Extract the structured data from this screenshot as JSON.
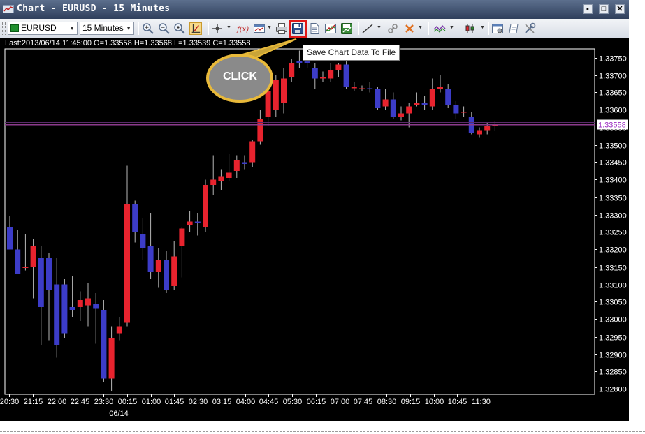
{
  "window": {
    "title": "Chart - EURUSD - 15 Minutes",
    "minimize_glyph": "▪",
    "restore_glyph": "□",
    "close_glyph": "✕"
  },
  "toolbar": {
    "symbol_value": "EURUSD",
    "timeframe_value": "15 Minutes",
    "icons": [
      "zoom-in-icon",
      "zoom-out-icon",
      "zoom-reset-icon",
      "auto-scroll-icon",
      "crosshair-icon",
      "indicator-fx-icon",
      "chart-type-icon",
      "print-icon",
      "save-icon",
      "document-icon",
      "line-chart-icon",
      "export-chart-icon",
      "trend-line-icon",
      "link-icon",
      "delete-objects-icon",
      "wave-icon",
      "candlestick-icon",
      "properties-icon",
      "template-icon",
      "tools-icon"
    ],
    "tooltip": "Save Chart Data To File"
  },
  "info_line": "Last:2013/06/14 11:45:00 O=1.33558 H=1.33568 L=1.33539 C=1.33558",
  "callout_label": "CLICK",
  "colors": {
    "bull": "#e8232e",
    "bear": "#3c3cc8",
    "axis": "#ffffff",
    "price_line": "#8b3a8b",
    "highlight": "#e01818"
  },
  "chart_data": {
    "type": "candlestick",
    "y_ticks": [
      "1.33750",
      "1.33700",
      "1.33650",
      "1.33600",
      "1.33550",
      "1.33500",
      "1.33450",
      "1.33400",
      "1.33350",
      "1.33300",
      "1.33250",
      "1.33200",
      "1.33150",
      "1.33100",
      "1.33050",
      "1.33000",
      "1.32950",
      "1.32900",
      "1.32850",
      "1.32800"
    ],
    "x_ticks": [
      "20:30",
      "21:15",
      "22:00",
      "22:45",
      "23:30",
      "00:15",
      "01:00",
      "01:45",
      "02:30",
      "03:15",
      "04:00",
      "04:45",
      "05:30",
      "06:15",
      "07:00",
      "07:45",
      "08:30",
      "09:15",
      "10:00",
      "10:45",
      "11:30"
    ],
    "date_label": "06/14",
    "ylim": [
      1.32785,
      1.33775
    ],
    "current_price": "1.33558",
    "candles": [
      {
        "o": 1.33265,
        "h": 1.33295,
        "l": 1.332,
        "c": 1.332
      },
      {
        "o": 1.332,
        "h": 1.33255,
        "l": 1.3313,
        "c": 1.3313
      },
      {
        "o": 1.3315,
        "h": 1.33245,
        "l": 1.3314,
        "c": 1.3315
      },
      {
        "o": 1.3315,
        "h": 1.3323,
        "l": 1.3306,
        "c": 1.3321
      },
      {
        "o": 1.33175,
        "h": 1.3321,
        "l": 1.32925,
        "c": 1.33035
      },
      {
        "o": 1.33175,
        "h": 1.3319,
        "l": 1.3294,
        "c": 1.33085
      },
      {
        "o": 1.331,
        "h": 1.33175,
        "l": 1.3289,
        "c": 1.32925
      },
      {
        "o": 1.331,
        "h": 1.33115,
        "l": 1.32945,
        "c": 1.3296
      },
      {
        "o": 1.33035,
        "h": 1.33125,
        "l": 1.33005,
        "c": 1.33025
      },
      {
        "o": 1.33035,
        "h": 1.3308,
        "l": 1.32995,
        "c": 1.33055
      },
      {
        "o": 1.3304,
        "h": 1.33105,
        "l": 1.3298,
        "c": 1.3306
      },
      {
        "o": 1.33045,
        "h": 1.33075,
        "l": 1.3293,
        "c": 1.3303
      },
      {
        "o": 1.33025,
        "h": 1.33055,
        "l": 1.3282,
        "c": 1.3283
      },
      {
        "o": 1.3283,
        "h": 1.3298,
        "l": 1.32795,
        "c": 1.32945
      },
      {
        "o": 1.3296,
        "h": 1.33005,
        "l": 1.3294,
        "c": 1.3298
      },
      {
        "o": 1.3299,
        "h": 1.3344,
        "l": 1.3298,
        "c": 1.3333
      },
      {
        "o": 1.3333,
        "h": 1.3334,
        "l": 1.3322,
        "c": 1.3325
      },
      {
        "o": 1.33245,
        "h": 1.3329,
        "l": 1.3317,
        "c": 1.33205
      },
      {
        "o": 1.3321,
        "h": 1.33305,
        "l": 1.33115,
        "c": 1.33135
      },
      {
        "o": 1.33135,
        "h": 1.33205,
        "l": 1.3309,
        "c": 1.3317
      },
      {
        "o": 1.3317,
        "h": 1.33195,
        "l": 1.33075,
        "c": 1.33085
      },
      {
        "o": 1.33095,
        "h": 1.33225,
        "l": 1.33085,
        "c": 1.3318
      },
      {
        "o": 1.3321,
        "h": 1.33265,
        "l": 1.3312,
        "c": 1.3326
      },
      {
        "o": 1.3327,
        "h": 1.3331,
        "l": 1.3325,
        "c": 1.3328
      },
      {
        "o": 1.3328,
        "h": 1.33305,
        "l": 1.3324,
        "c": 1.33275
      },
      {
        "o": 1.33265,
        "h": 1.334,
        "l": 1.3325,
        "c": 1.33385
      },
      {
        "o": 1.33385,
        "h": 1.3347,
        "l": 1.33355,
        "c": 1.334
      },
      {
        "o": 1.33395,
        "h": 1.3343,
        "l": 1.3337,
        "c": 1.3341
      },
      {
        "o": 1.33405,
        "h": 1.33475,
        "l": 1.33395,
        "c": 1.3342
      },
      {
        "o": 1.33425,
        "h": 1.3347,
        "l": 1.33405,
        "c": 1.33455
      },
      {
        "o": 1.3345,
        "h": 1.3347,
        "l": 1.3343,
        "c": 1.33445
      },
      {
        "o": 1.3345,
        "h": 1.33515,
        "l": 1.33435,
        "c": 1.3351
      },
      {
        "o": 1.3351,
        "h": 1.336,
        "l": 1.335,
        "c": 1.33575
      },
      {
        "o": 1.3358,
        "h": 1.3366,
        "l": 1.33555,
        "c": 1.33655
      },
      {
        "o": 1.336,
        "h": 1.337,
        "l": 1.3358,
        "c": 1.33685
      },
      {
        "o": 1.3362,
        "h": 1.3372,
        "l": 1.3359,
        "c": 1.3369
      },
      {
        "o": 1.33695,
        "h": 1.33745,
        "l": 1.3368,
        "c": 1.33735
      },
      {
        "o": 1.3374,
        "h": 1.3377,
        "l": 1.3372,
        "c": 1.33735
      },
      {
        "o": 1.3374,
        "h": 1.33745,
        "l": 1.3372,
        "c": 1.33735
      },
      {
        "o": 1.3372,
        "h": 1.33735,
        "l": 1.3366,
        "c": 1.3369
      },
      {
        "o": 1.3369,
        "h": 1.3371,
        "l": 1.3368,
        "c": 1.33695
      },
      {
        "o": 1.3369,
        "h": 1.33735,
        "l": 1.3368,
        "c": 1.33715
      },
      {
        "o": 1.33715,
        "h": 1.33735,
        "l": 1.33695,
        "c": 1.3373
      },
      {
        "o": 1.3373,
        "h": 1.3374,
        "l": 1.3366,
        "c": 1.33665
      },
      {
        "o": 1.33665,
        "h": 1.3368,
        "l": 1.33655,
        "c": 1.33665
      },
      {
        "o": 1.3366,
        "h": 1.3367,
        "l": 1.33655,
        "c": 1.33662
      },
      {
        "o": 1.33662,
        "h": 1.3368,
        "l": 1.3365,
        "c": 1.3366
      },
      {
        "o": 1.3366,
        "h": 1.33665,
        "l": 1.336,
        "c": 1.33605
      },
      {
        "o": 1.3361,
        "h": 1.3366,
        "l": 1.336,
        "c": 1.3363
      },
      {
        "o": 1.3363,
        "h": 1.3365,
        "l": 1.33575,
        "c": 1.3358
      },
      {
        "o": 1.3358,
        "h": 1.3361,
        "l": 1.3357,
        "c": 1.3359
      },
      {
        "o": 1.3359,
        "h": 1.3362,
        "l": 1.3355,
        "c": 1.3361
      },
      {
        "o": 1.33615,
        "h": 1.3365,
        "l": 1.3361,
        "c": 1.3362
      },
      {
        "o": 1.3362,
        "h": 1.3364,
        "l": 1.336,
        "c": 1.33615
      },
      {
        "o": 1.3361,
        "h": 1.3369,
        "l": 1.336,
        "c": 1.3366
      },
      {
        "o": 1.3366,
        "h": 1.337,
        "l": 1.3365,
        "c": 1.33665
      },
      {
        "o": 1.3366,
        "h": 1.33675,
        "l": 1.33605,
        "c": 1.33615
      },
      {
        "o": 1.33615,
        "h": 1.33625,
        "l": 1.33575,
        "c": 1.3359
      },
      {
        "o": 1.33595,
        "h": 1.3361,
        "l": 1.3358,
        "c": 1.33595
      },
      {
        "o": 1.3358,
        "h": 1.33595,
        "l": 1.3353,
        "c": 1.33535
      },
      {
        "o": 1.3353,
        "h": 1.3355,
        "l": 1.3352,
        "c": 1.3354
      },
      {
        "o": 1.3354,
        "h": 1.33565,
        "l": 1.3353,
        "c": 1.33555
      },
      {
        "o": 1.33558,
        "h": 1.33568,
        "l": 1.33539,
        "c": 1.33558
      }
    ]
  }
}
